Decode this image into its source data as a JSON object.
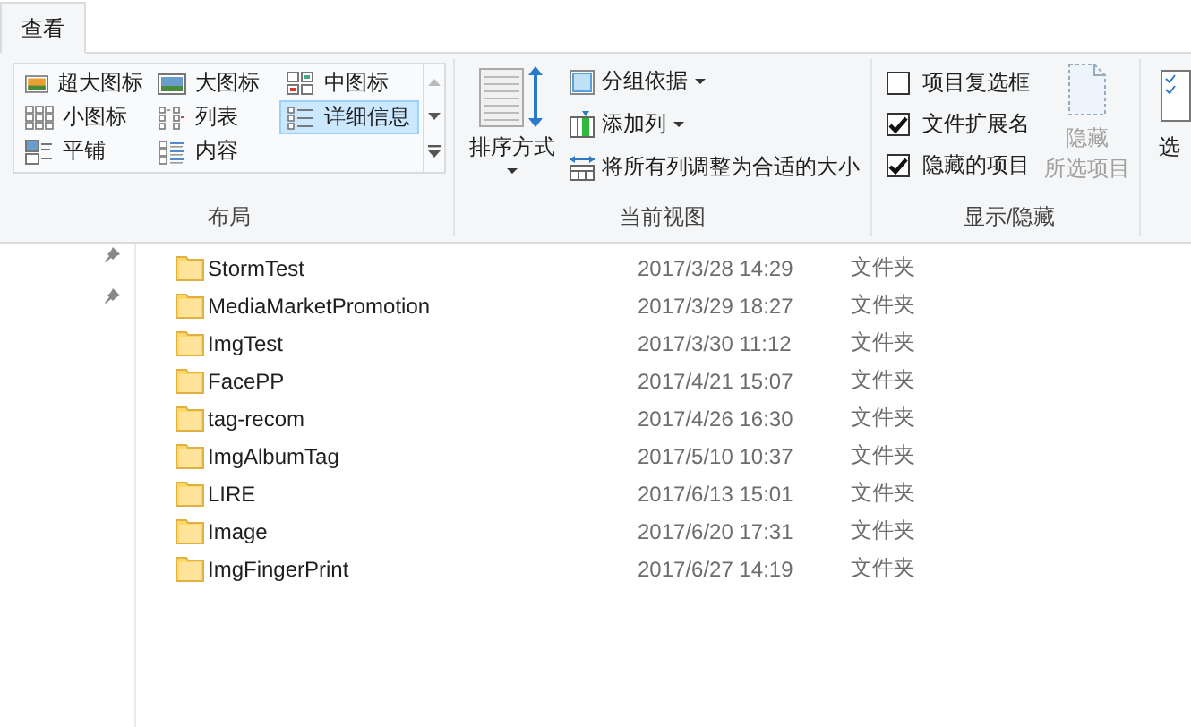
{
  "tabs": [
    {
      "label": "查看",
      "selected": true
    }
  ],
  "layout_group": {
    "label": "布局",
    "items": [
      {
        "kind": "xl",
        "label": "超大图标",
        "selected": false
      },
      {
        "kind": "large",
        "label": "大图标",
        "selected": false
      },
      {
        "kind": "medium",
        "label": "中图标",
        "selected": false
      },
      {
        "kind": "small",
        "label": "小图标",
        "selected": false
      },
      {
        "kind": "list",
        "label": "列表",
        "selected": false
      },
      {
        "kind": "details",
        "label": "详细信息",
        "selected": true
      },
      {
        "kind": "tiles",
        "label": "平铺",
        "selected": false
      },
      {
        "kind": "content",
        "label": "内容",
        "selected": false
      }
    ]
  },
  "current_view_group": {
    "label": "当前视图",
    "sort_button": {
      "label": "排序方式"
    },
    "commands": [
      {
        "kind": "group",
        "label": "分组依据",
        "dropdown": true
      },
      {
        "kind": "addcol",
        "label": "添加列",
        "dropdown": true
      },
      {
        "kind": "fit",
        "label": "将所有列调整为合适的大小",
        "dropdown": false
      }
    ]
  },
  "show_hide_group": {
    "label": "显示/隐藏",
    "checkboxes": [
      {
        "label": "项目复选框",
        "checked": false
      },
      {
        "label": "文件扩展名",
        "checked": true
      },
      {
        "label": "隐藏的项目",
        "checked": true
      }
    ],
    "hide_button": {
      "label_lines": [
        "隐藏",
        "所选项目"
      ],
      "disabled": true
    }
  },
  "options_button": {
    "label": "选"
  },
  "files": [
    {
      "name": "StormTest",
      "modified": "2017/3/28 14:29",
      "type": "文件夹"
    },
    {
      "name": "MediaMarketPromotion",
      "modified": "2017/3/29 18:27",
      "type": "文件夹"
    },
    {
      "name": "ImgTest",
      "modified": "2017/3/30 11:12",
      "type": "文件夹"
    },
    {
      "name": "FacePP",
      "modified": "2017/4/21 15:07",
      "type": "文件夹"
    },
    {
      "name": "tag-recom",
      "modified": "2017/4/26 16:30",
      "type": "文件夹"
    },
    {
      "name": "ImgAlbumTag",
      "modified": "2017/5/10 10:37",
      "type": "文件夹"
    },
    {
      "name": "LIRE",
      "modified": "2017/6/13 15:01",
      "type": "文件夹"
    },
    {
      "name": "Image",
      "modified": "2017/6/20 17:31",
      "type": "文件夹"
    },
    {
      "name": "ImgFingerPrint",
      "modified": "2017/6/27 14:19",
      "type": "文件夹"
    }
  ]
}
